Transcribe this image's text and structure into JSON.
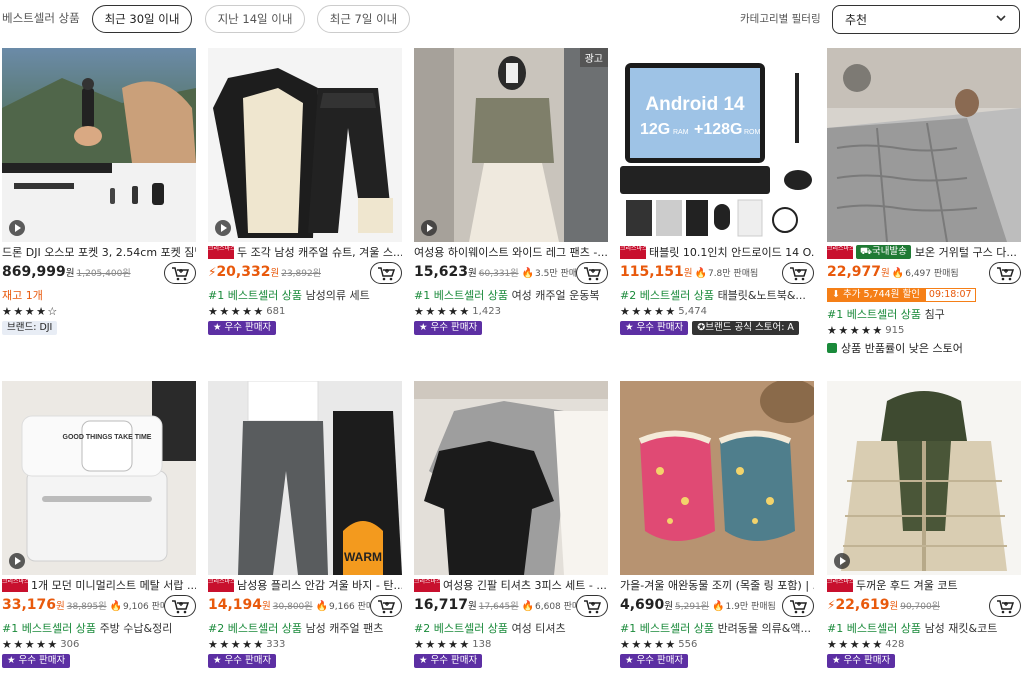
{
  "header": {
    "title": "베스트셀러 상품",
    "tabs": [
      {
        "label": "최근 30일 이내",
        "active": true
      },
      {
        "label": "지난 14일 이내",
        "active": false
      },
      {
        "label": "최근 7일 이내",
        "active": false
      }
    ],
    "filter_label": "카테고리별 필터링",
    "sort_value": "추천"
  },
  "colors": {
    "accent": "#e8590c",
    "rank_green": "#1a8a3a",
    "seller_purple": "#5c2fa3",
    "promo_red": "#c8102e"
  },
  "products": [
    {
      "title": "드론 DJI 오스모 포켓 3, 2.54cm 포켓 짐벌...",
      "price": "869,999",
      "won": "원",
      "original": "1,205,400원",
      "stock": "재고 1개",
      "rating": 3.5,
      "brand": "브랜드: DJI"
    },
    {
      "promo": "크리스마스 할인",
      "title": "두 조각 남성 캐주얼 슈트, 겨울 스...",
      "price": "20,332",
      "won": "원",
      "original": "23,892원",
      "rank": "#1 베스트셀러 상품",
      "rank_cat": "남성의류 세트",
      "rating": 4.5,
      "reviews": "681",
      "seller": "우수 판매자"
    },
    {
      "ad": "광고",
      "title": "여성용 하이웨이스트 와이드 레그 팬츠 -...",
      "price": "15,623",
      "won": "원",
      "original": "60,331원",
      "sold": "3.5만 판매됨",
      "rank": "#1 베스트셀러 상품",
      "rank_cat": "여성 캐주얼 운동복",
      "rating": 4.5,
      "reviews": "1,423",
      "seller": "우수 판매자"
    },
    {
      "promo": "크리스마스 할인",
      "title": "태블릿 10.1인치 안드로이드 14 O...",
      "price": "115,151",
      "won": "원",
      "sold": "7.8만 판매됨",
      "rank": "#2 베스트셀러 상품",
      "rank_cat": "태블릿&노트북&...",
      "rating": 4.5,
      "reviews": "5,474",
      "seller": "우수 판매자",
      "brand_official": "브랜드 공식 스토어: A",
      "image_text": {
        "os": "Android 14",
        "ram": "12G",
        "ram_unit": "RAM",
        "rom": "+128G",
        "rom_unit": "ROM"
      }
    },
    {
      "promo": "크리스마스 할인",
      "domestic": "국내발송",
      "title": "보온 거위털 구스 다...",
      "price": "22,977",
      "won": "원",
      "sold": "6,497 판매됨",
      "extra_discount": "추가 5,744원 할인",
      "timer": "09:18:07",
      "rank": "#1 베스트셀러 상품",
      "rank_cat": "침구",
      "rating": 4.5,
      "reviews": "915",
      "returns": "상품 반품률이 낮은 스토어"
    },
    {
      "promo": "크리스마스 할인",
      "title": "1개 모던 미니멀리스트 메탈 서랍 ...",
      "price": "33,176",
      "won": "원",
      "original": "38,895원",
      "sold": "9,106 판매됨",
      "rank": "#1 베스트셀러 상품",
      "rank_cat": "주방 수납&정리",
      "rating": 5,
      "reviews": "306",
      "seller": "우수 판매자",
      "image_text": "GOOD THINGS TAKE TIME"
    },
    {
      "promo": "크리스마스 할인",
      "title": "남성용 플리스 안감 겨울 바지 - 탄...",
      "price": "14,194",
      "won": "원",
      "original": "30,800원",
      "sold": "9,166 판매됨",
      "rank": "#2 베스트셀러 상품",
      "rank_cat": "남성 캐주얼 팬츠",
      "rating": 4.5,
      "reviews": "333",
      "seller": "우수 판매자",
      "image_text": "WARM"
    },
    {
      "promo": "크리스마스 할인",
      "title": "여성용 긴팔 티셔츠 3피스 세트 - ...",
      "price": "16,717",
      "won": "원",
      "original": "17,645원",
      "sold": "6,608 판매됨",
      "rank": "#2 베스트셀러 상품",
      "rank_cat": "여성 티셔츠",
      "rating": 4.5,
      "reviews": "138",
      "seller": "우수 판매자"
    },
    {
      "title": "가을-겨울 애완동물 조끼 (목줄 링 포함) | ...",
      "price": "4,690",
      "won": "원",
      "original": "5,291원",
      "sold": "1.9만 판매됨",
      "rank": "#1 베스트셀러 상품",
      "rank_cat": "반려동물 의류&액...",
      "rating": 5,
      "reviews": "556",
      "seller": "우수 판매자"
    },
    {
      "promo": "크리스마스 할인",
      "title": "두꺼운 후드 겨울 코트",
      "price": "22,619",
      "won": "원",
      "original": "90,700원",
      "rank": "#1 베스트셀러 상품",
      "rank_cat": "남성 재킷&코트",
      "rating": 4.5,
      "reviews": "428",
      "seller": "우수 판매자"
    }
  ]
}
